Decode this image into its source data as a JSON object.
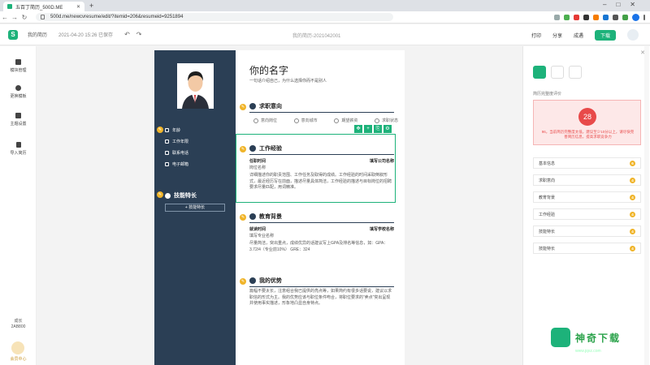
{
  "browser": {
    "tab_title": "五百丁简历_500D.ME",
    "url": "500d.me/newcvresume/edit/?itemid=206&resumeid=9251894"
  },
  "header": {
    "menu": "我的简历",
    "saved": "2021-04-20 15:26 已保存",
    "doc_name": "我的简历-2021042001",
    "print": "打印",
    "share": "分享",
    "tips": "成遇",
    "download": "下载"
  },
  "leftbar": {
    "items": [
      {
        "label": "模块管理"
      },
      {
        "label": "更换模板"
      },
      {
        "label": "主题设置"
      },
      {
        "label": "导入简历"
      }
    ],
    "bottom1": "成长",
    "bottom2": "2AB800",
    "vip": "会员中心"
  },
  "resume": {
    "name": "你的名字",
    "motto": "一句话介绍自己，为什么选择你而不是别人",
    "side_fields": [
      "年龄",
      "工作年限",
      "联系电话",
      "电子邮箱"
    ],
    "skill_title": "技能特长",
    "skill_btn": "+ 技能特长",
    "sec_intent": "求职意向",
    "intent_fields": [
      "意向岗位",
      "意向城市",
      "期望薪资",
      "求职状态"
    ],
    "sec_work": "工作经验",
    "work_time": "任职时间",
    "work_company": "填写公司名称",
    "work_role": "岗位名称",
    "work_desc": "详细描述你的职责范围、工作任务及取得的成绩。工作经验的时间采取倒叙形式，最近经历写在前面，描述尽量具体简洁，工作经验的描述与目标岗位的招聘要求尽量匹配，用词精准。",
    "sec_edu": "教育背景",
    "edu_time": "就读时间",
    "edu_school": "填写学校名称",
    "edu_major": "填写专业名称",
    "edu_desc": "尽量简洁，突出重点，成绩优异的话建议写上GPA及排名等信息，如：GPA：3.72/4（专业前10%） GRE：324",
    "sec_adv": "我的优势",
    "adv_desc": "篇幅不要太长，注意组合我已提供的亮点等，如果简约有很多话要说，建议以求职信的形式为主。我的优势应该与职位条件吻合，将职位要求的“卖点”突出呈现并使用事实描述，形象地凸显自身特点。"
  },
  "rpanel": {
    "label": "简历完整度评价",
    "score": "28",
    "score_text": "96，当前简历完整度太低，建议至少10分以上，请尽快完善简历信息，提高求职竞争力",
    "checks": [
      {
        "label": "基本信息",
        "n": "6"
      },
      {
        "label": "求职意向",
        "n": "4"
      },
      {
        "label": "教育背景",
        "n": "4"
      },
      {
        "label": "工作经验",
        "n": "4"
      },
      {
        "label": "技能特长",
        "n": "4"
      },
      {
        "label": "技能特长",
        "n": "4"
      }
    ]
  },
  "watermark": {
    "text": "神奇下载",
    "url": "www.jqxz.com"
  }
}
